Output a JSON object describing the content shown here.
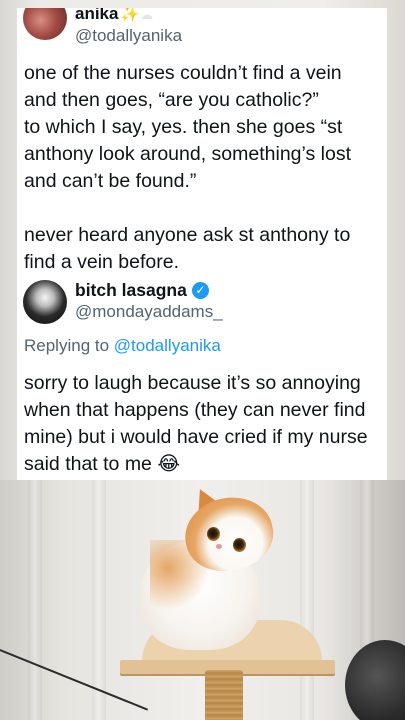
{
  "tweet": {
    "author_name": "anika",
    "author_emoji": "✨",
    "author_emoji2": "☁",
    "author_handle": "@todallyanika",
    "text_part1": "one of the nurses couldn’t find a vein\nand then goes, “are you catholic?”\nto which I say, yes. then she goes “st\nanthony look around, something’s lost\nand can’t be found.”",
    "text_part2": "never heard anyone ask st anthony to\nfind a vein before."
  },
  "reply": {
    "author_name": "bitch lasagna",
    "verified": "✓",
    "author_handle": "@mondayaddams_",
    "replying_prefix": "Replying to",
    "replying_to": "@todallyanika",
    "text": "sorry to laugh because it’s so annoying\nwhen that happens (they can never find\nmine) but i would have cried if my nurse\nsaid that to me 😂"
  },
  "colors": {
    "link": "#1d9bf0",
    "muted": "#536471",
    "text": "#0f1419"
  }
}
